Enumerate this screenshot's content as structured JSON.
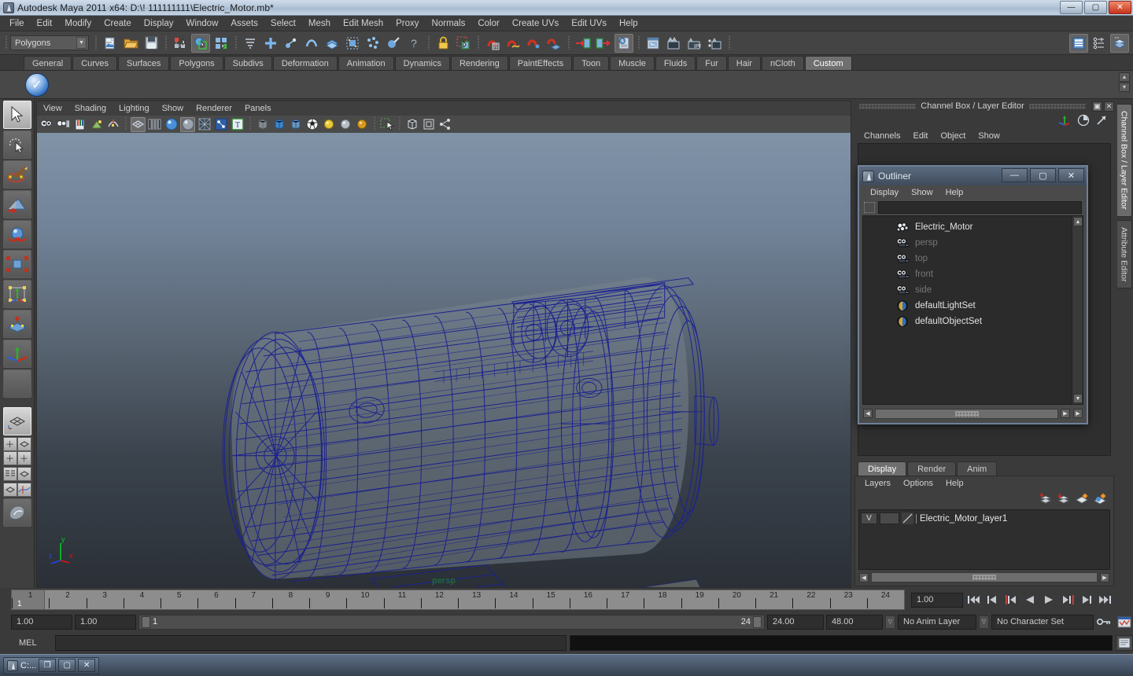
{
  "window": {
    "title": "Autodesk Maya 2011 x64: D:\\! 111111111\\Electric_Motor.mb*",
    "minimize": "—",
    "maximize": "▢",
    "close": "✕"
  },
  "menubar": {
    "items": [
      "File",
      "Edit",
      "Modify",
      "Create",
      "Display",
      "Window",
      "Assets",
      "Select",
      "Mesh",
      "Edit Mesh",
      "Proxy",
      "Normals",
      "Color",
      "Create UVs",
      "Edit UVs",
      "Help"
    ]
  },
  "status_toolbar": {
    "menu_set": "Polygons",
    "menu_set_arrow": "▼"
  },
  "shelf": {
    "tabs": [
      "General",
      "Curves",
      "Surfaces",
      "Polygons",
      "Subdivs",
      "Deformation",
      "Animation",
      "Dynamics",
      "Rendering",
      "PaintEffects",
      "Toon",
      "Muscle",
      "Fluids",
      "Fur",
      "Hair",
      "nCloth",
      "Custom"
    ],
    "active_tab": "Custom",
    "scroll_up": "▲",
    "scroll_down": "▼"
  },
  "viewport": {
    "menus": [
      "View",
      "Shading",
      "Lighting",
      "Show",
      "Renderer",
      "Panels"
    ],
    "camera_label": "persp",
    "axis": {
      "x": "x",
      "y": "y",
      "z": "z"
    },
    "background_top": "#7f93a8",
    "background_bottom": "#2a2f36",
    "wireframe_color": "#1a1f8c",
    "model_fill": "#77808a"
  },
  "channel_box": {
    "panel_title": "Channel Box / Layer Editor",
    "restore_btn": "▣",
    "close_btn": "✕",
    "menus": [
      "Channels",
      "Edit",
      "Object",
      "Show"
    ]
  },
  "vertical_tabs": {
    "items": [
      "Channel Box / Layer Editor",
      "Attribute Editor"
    ],
    "active": "Channel Box / Layer Editor"
  },
  "outliner": {
    "title": "Outliner",
    "minimize": "—",
    "maximize": "▢",
    "close": "✕",
    "menus": [
      "Display",
      "Show",
      "Help"
    ],
    "search_value": "",
    "items": [
      {
        "label": "Electric_Motor",
        "icon": "mesh-icon",
        "dim": false
      },
      {
        "label": "persp",
        "icon": "camera-icon",
        "dim": true
      },
      {
        "label": "top",
        "icon": "camera-icon",
        "dim": true
      },
      {
        "label": "front",
        "icon": "camera-icon",
        "dim": true
      },
      {
        "label": "side",
        "icon": "camera-icon",
        "dim": true
      },
      {
        "label": "defaultLightSet",
        "icon": "set-icon",
        "dim": false
      },
      {
        "label": "defaultObjectSet",
        "icon": "set-icon",
        "dim": false
      }
    ],
    "scroll_up": "▲",
    "scroll_down": "▼",
    "hscroll_left": "◀",
    "hscroll_right": "▶"
  },
  "layer_editor": {
    "tabs": [
      "Display",
      "Render",
      "Anim"
    ],
    "active_tab": "Display",
    "menus": [
      "Layers",
      "Options",
      "Help"
    ],
    "layers": [
      {
        "visibility": "V",
        "state": "",
        "name": "Electric_Motor_layer1"
      }
    ],
    "hscroll_left": "◀",
    "hscroll_right": "▶"
  },
  "timeline": {
    "frame_numbers": [
      "1",
      "2",
      "3",
      "4",
      "5",
      "6",
      "7",
      "8",
      "9",
      "10",
      "11",
      "12",
      "13",
      "14",
      "15",
      "16",
      "17",
      "18",
      "19",
      "20",
      "21",
      "22",
      "23",
      "24"
    ],
    "current_frame": "1",
    "current_frame_field": "1.00",
    "playback_buttons": [
      "|◀◀",
      "|◀",
      "|◀|",
      "◀",
      "▶",
      "|▶|",
      "▶|",
      "▶▶|"
    ]
  },
  "range_slider": {
    "anim_start": "1.00",
    "anim_end": "1.00",
    "range_start": "1",
    "range_end": "24",
    "playback_end": "24.00",
    "anim_total_end": "48.00",
    "anim_layer": "No Anim Layer",
    "anim_layer_arrow": "▽",
    "character_set": "No Character Set",
    "character_set_arrow": "▽"
  },
  "command_line": {
    "language_label": "MEL",
    "input_value": "",
    "output_value": ""
  },
  "taskbar": {
    "item_label": "C:...",
    "restore": "❐",
    "maximize": "▢",
    "close": "✕"
  }
}
